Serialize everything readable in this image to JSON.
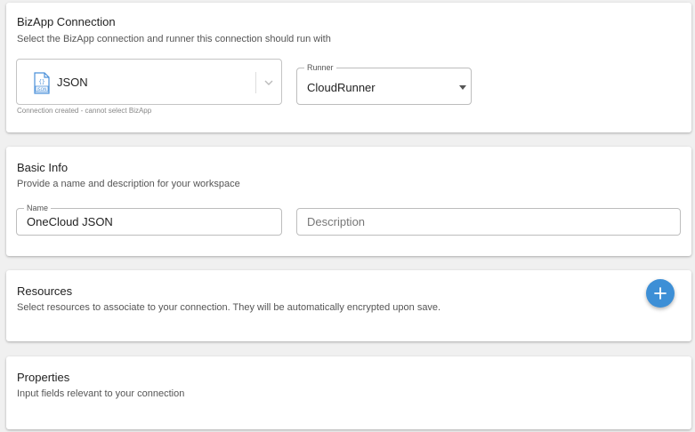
{
  "bizapp": {
    "title": "BizApp Connection",
    "subtitle": "Select the BizApp connection and runner this connection should run with",
    "selected_app": "JSON",
    "icon": "json-file-icon",
    "helper": "Connection created - cannot select BizApp",
    "runner_label": "Runner",
    "runner_value": "CloudRunner"
  },
  "basic_info": {
    "title": "Basic Info",
    "subtitle": "Provide a name and description for your workspace",
    "name_label": "Name",
    "name_value": "OneCloud JSON",
    "description_placeholder": "Description"
  },
  "resources": {
    "title": "Resources",
    "subtitle": "Select resources to associate to your connection. They will be automatically encrypted upon save.",
    "add_icon": "plus-icon"
  },
  "properties": {
    "title": "Properties",
    "subtitle": "Input fields relevant to your connection"
  },
  "colors": {
    "accent": "#3d8fd6",
    "background": "#f0f0f0",
    "card": "#ffffff"
  }
}
